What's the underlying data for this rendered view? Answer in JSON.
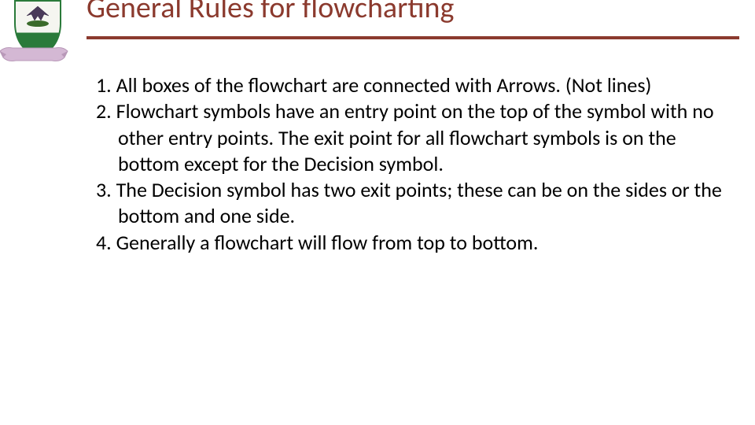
{
  "header": {
    "title": "General Rules for flowcharting"
  },
  "logo": {
    "name": "university-crest"
  },
  "rules": {
    "items": [
      {
        "num": "1.",
        "text": "All boxes of the flowchart are connected with Arrows. (Not lines)"
      },
      {
        "num": "2.",
        "text": "Flowchart symbols have an entry point on the top of the symbol with no other entry points. The exit point for all flowchart symbols is on the bottom except for the Decision symbol."
      },
      {
        "num": "3.",
        "text": "The Decision symbol has two exit points; these can be on the sides or the bottom and one side."
      },
      {
        "num": "4.",
        "text": "Generally a flowchart will flow from top to bottom."
      }
    ]
  }
}
